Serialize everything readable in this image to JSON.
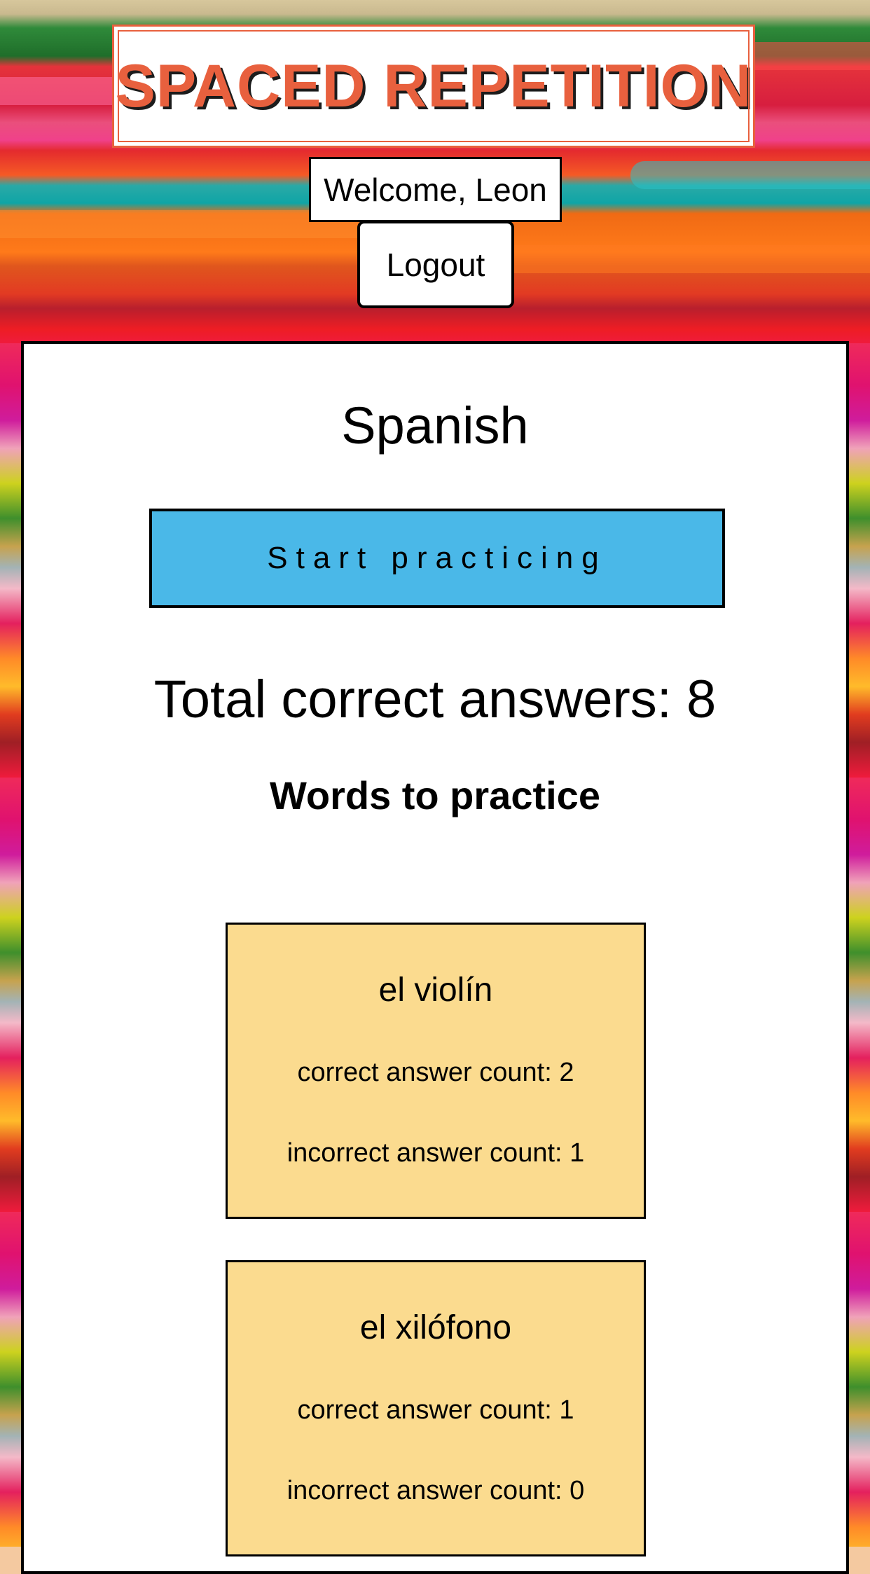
{
  "header": {
    "app_title": "SPACED REPETITION",
    "welcome_text": "Welcome, Leon",
    "logout_label": "Logout"
  },
  "dashboard": {
    "language": "Spanish",
    "start_label": "Start practicing",
    "total_correct_text": "Total correct answers: 8",
    "words_heading": "Words to practice",
    "words": [
      {
        "word": "el violín",
        "correct_text": "correct answer count: 2",
        "incorrect_text": "incorrect answer count: 1"
      },
      {
        "word": "el xilófono",
        "correct_text": "correct answer count: 1",
        "incorrect_text": "incorrect answer count: 0"
      }
    ]
  },
  "colors": {
    "title_accent": "#e8603e",
    "start_button": "#4ab8e8",
    "word_card": "#fbdb8f"
  }
}
